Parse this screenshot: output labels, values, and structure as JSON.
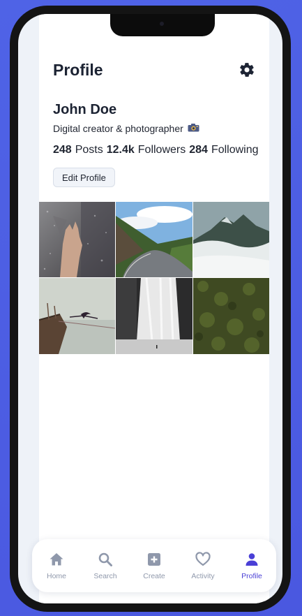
{
  "header": {
    "title": "Profile",
    "settings_icon": "gear-icon"
  },
  "profile": {
    "name": "John Doe",
    "bio": "Digital creator & photographer",
    "bio_icon": "camera-emoji-icon",
    "posts_count": "248",
    "posts_label": "Posts",
    "followers_count": "12.4k",
    "followers_label": "Followers",
    "following_count": "284",
    "following_label": "Following",
    "edit_label": "Edit Profile"
  },
  "photos": [
    {
      "subject": "hand on rainy glass"
    },
    {
      "subject": "mountain road"
    },
    {
      "subject": "misty mountain peaks"
    },
    {
      "subject": "bird on old ship"
    },
    {
      "subject": "waterfall"
    },
    {
      "subject": "green forest aerial"
    }
  ],
  "tabbar": {
    "items": [
      {
        "label": "Home",
        "icon": "home-icon",
        "active": false
      },
      {
        "label": "Search",
        "icon": "search-icon",
        "active": false
      },
      {
        "label": "Create",
        "icon": "plus-square-icon",
        "active": false
      },
      {
        "label": "Activity",
        "icon": "heart-icon",
        "active": false
      },
      {
        "label": "Profile",
        "icon": "user-icon",
        "active": true
      }
    ]
  },
  "colors": {
    "accent": "#4a3fd6",
    "inactive": "#8f98ab",
    "background": "#4f63e6"
  }
}
